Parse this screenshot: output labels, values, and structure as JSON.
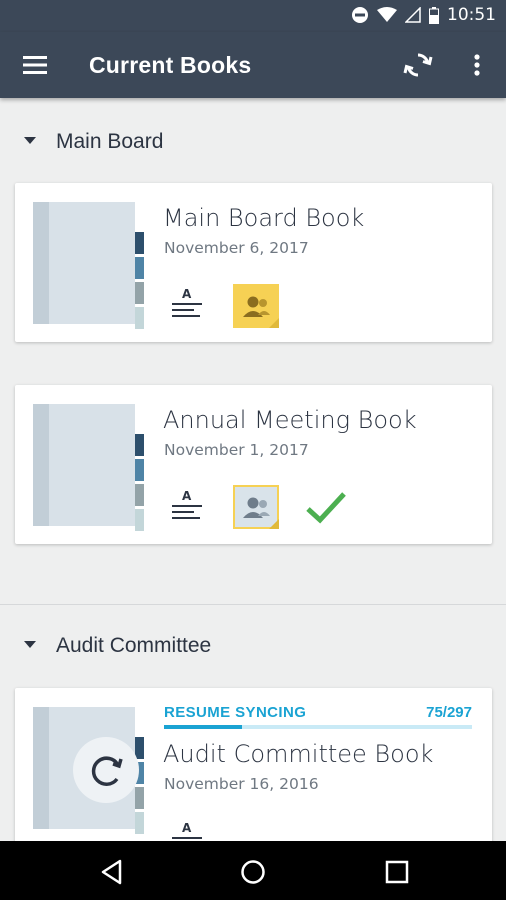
{
  "status_bar": {
    "time": "10:51",
    "icons": [
      "do-not-disturb-icon",
      "wifi-icon",
      "signal-icon",
      "battery-icon"
    ]
  },
  "app_bar": {
    "title": "Current Books",
    "icons": [
      "menu-icon",
      "sync-icon",
      "more-vert-icon"
    ]
  },
  "sections": [
    {
      "label": "Main Board",
      "books": [
        {
          "name": "Main Board Book",
          "date": "November 6, 2017",
          "annotation_letter": "A",
          "people_state": "active",
          "downloaded": false
        },
        {
          "name": "Annual Meeting Book",
          "date": "November 1, 2017",
          "annotation_letter": "A",
          "people_state": "inactive",
          "downloaded": true
        }
      ]
    },
    {
      "label": "Audit Committee",
      "books": [
        {
          "name": "Audit Committee Book",
          "date": "November 16, 2016",
          "annotation_letter": "A",
          "sync": {
            "label": "RESUME SYNCING",
            "count": "75/297",
            "progress": 0.253
          }
        }
      ]
    }
  ],
  "colors": {
    "app_bar": "#3c4858",
    "accent": "#1aa3d3",
    "check": "#4caf50",
    "people_active": "#f6d154",
    "tabs": [
      "#2d4f6c",
      "#4f84a6",
      "#93a3a8",
      "#c3d6d9"
    ]
  },
  "nav_bar": {
    "icons": [
      "back-icon",
      "home-icon",
      "recents-icon"
    ]
  }
}
